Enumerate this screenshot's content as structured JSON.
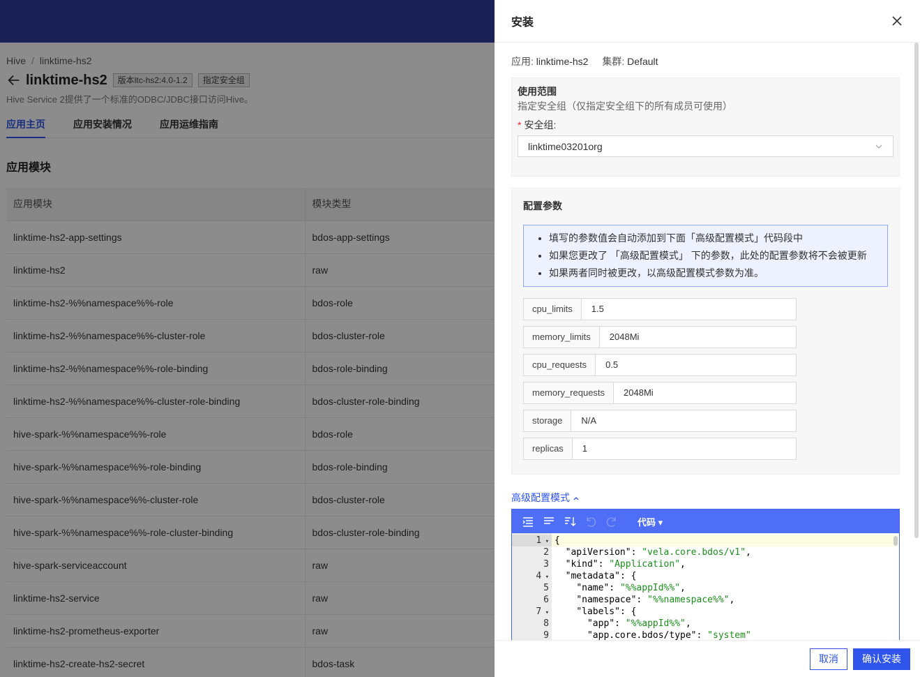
{
  "background": {
    "breadcrumb": {
      "root": "Hive",
      "separator": "/",
      "current": "linktime-hs2"
    },
    "app_title": "linktime-hs2",
    "tags": [
      "版本ltc-hs2:4.0-1.2",
      "指定安全组"
    ],
    "description": "Hive Service 2提供了一个标准的ODBC/JDBC接口访问Hive。",
    "tabs": [
      {
        "label": "应用主页",
        "active": true
      },
      {
        "label": "应用安装情况",
        "active": false
      },
      {
        "label": "应用运维指南",
        "active": false
      }
    ],
    "section_title": "应用模块",
    "table": {
      "columns": [
        "应用模块",
        "模块类型"
      ],
      "rows": [
        [
          "linktime-hs2-app-settings",
          "bdos-app-settings"
        ],
        [
          "linktime-hs2",
          "raw"
        ],
        [
          "linktime-hs2-%%namespace%%-role",
          "bdos-role"
        ],
        [
          "linktime-hs2-%%namespace%%-cluster-role",
          "bdos-cluster-role"
        ],
        [
          "linktime-hs2-%%namespace%%-role-binding",
          "bdos-role-binding"
        ],
        [
          "linktime-hs2-%%namespace%%-cluster-role-binding",
          "bdos-cluster-role-binding"
        ],
        [
          "hive-spark-%%namespace%%-role",
          "bdos-role"
        ],
        [
          "hive-spark-%%namespace%%-role-binding",
          "bdos-role-binding"
        ],
        [
          "hive-spark-%%namespace%%-cluster-role",
          "bdos-cluster-role"
        ],
        [
          "hive-spark-%%namespace%%-role-cluster-binding",
          "bdos-cluster-role-binding"
        ],
        [
          "hive-spark-serviceaccount",
          "raw"
        ],
        [
          "linktime-hs2-service",
          "raw"
        ],
        [
          "linktime-hs2-prometheus-exporter",
          "raw"
        ],
        [
          "linktime-hs2-create-hs2-secret",
          "bdos-task"
        ]
      ]
    }
  },
  "drawer": {
    "title": "安装",
    "app_label": "应用:",
    "app_value": "linktime-hs2",
    "cluster_label": "集群:",
    "cluster_value": "Default",
    "scope": {
      "title": "使用范围",
      "desc": "指定安全组（仅指定安全组下的所有成员可使用）",
      "required_mark": "*",
      "field_label": "安全组:",
      "selected": "linktime03201org"
    },
    "config": {
      "title": "配置参数",
      "notices": [
        "填写的参数值会自动添加到下面「高级配置模式」代码段中",
        "如果您更改了 「高级配置模式」 下的参数，此处的配置参数将不会被更新",
        "如果两者同时被更改，以高级配置模式参数为准。"
      ],
      "params": [
        {
          "key": "cpu_limits",
          "value": "1.5"
        },
        {
          "key": "memory_limits",
          "value": "2048Mi"
        },
        {
          "key": "cpu_requests",
          "value": "0.5"
        },
        {
          "key": "memory_requests",
          "value": "2048Mi"
        },
        {
          "key": "storage",
          "value": "N/A"
        },
        {
          "key": "replicas",
          "value": "1"
        }
      ]
    },
    "advanced": {
      "toggle_label": "高级配置模式",
      "mode_label": "代码",
      "line_numbers": [
        "1",
        "2",
        "3",
        "4",
        "5",
        "6",
        "7",
        "8",
        "9"
      ],
      "code_lines": [
        {
          "indent": "",
          "key": "",
          "value": "",
          "text": "{"
        },
        {
          "indent": "  ",
          "key": "\"apiVersion\"",
          "value": "\"vela.core.bdos/v1\"",
          "text": ","
        },
        {
          "indent": "  ",
          "key": "\"kind\"",
          "value": "\"Application\"",
          "text": ","
        },
        {
          "indent": "  ",
          "key": "\"metadata\"",
          "value": "",
          "text": ": {"
        },
        {
          "indent": "    ",
          "key": "\"name\"",
          "value": "\"%%appId%%\"",
          "text": ","
        },
        {
          "indent": "    ",
          "key": "\"namespace\"",
          "value": "\"%%namespace%%\"",
          "text": ","
        },
        {
          "indent": "    ",
          "key": "\"labels\"",
          "value": "",
          "text": ": {"
        },
        {
          "indent": "      ",
          "key": "\"app\"",
          "value": "\"%%appId%%\"",
          "text": ","
        },
        {
          "indent": "      ",
          "key": "\"app.core.bdos/type\"",
          "value": "\"system\"",
          "text": ""
        }
      ]
    },
    "footer": {
      "cancel": "取消",
      "confirm": "确认安装"
    }
  },
  "colors": {
    "primary": "#2f54eb",
    "topbar": "#2f3d9e",
    "editor_toolbar": "#4d6ef5",
    "string": "#1a8f1a"
  }
}
